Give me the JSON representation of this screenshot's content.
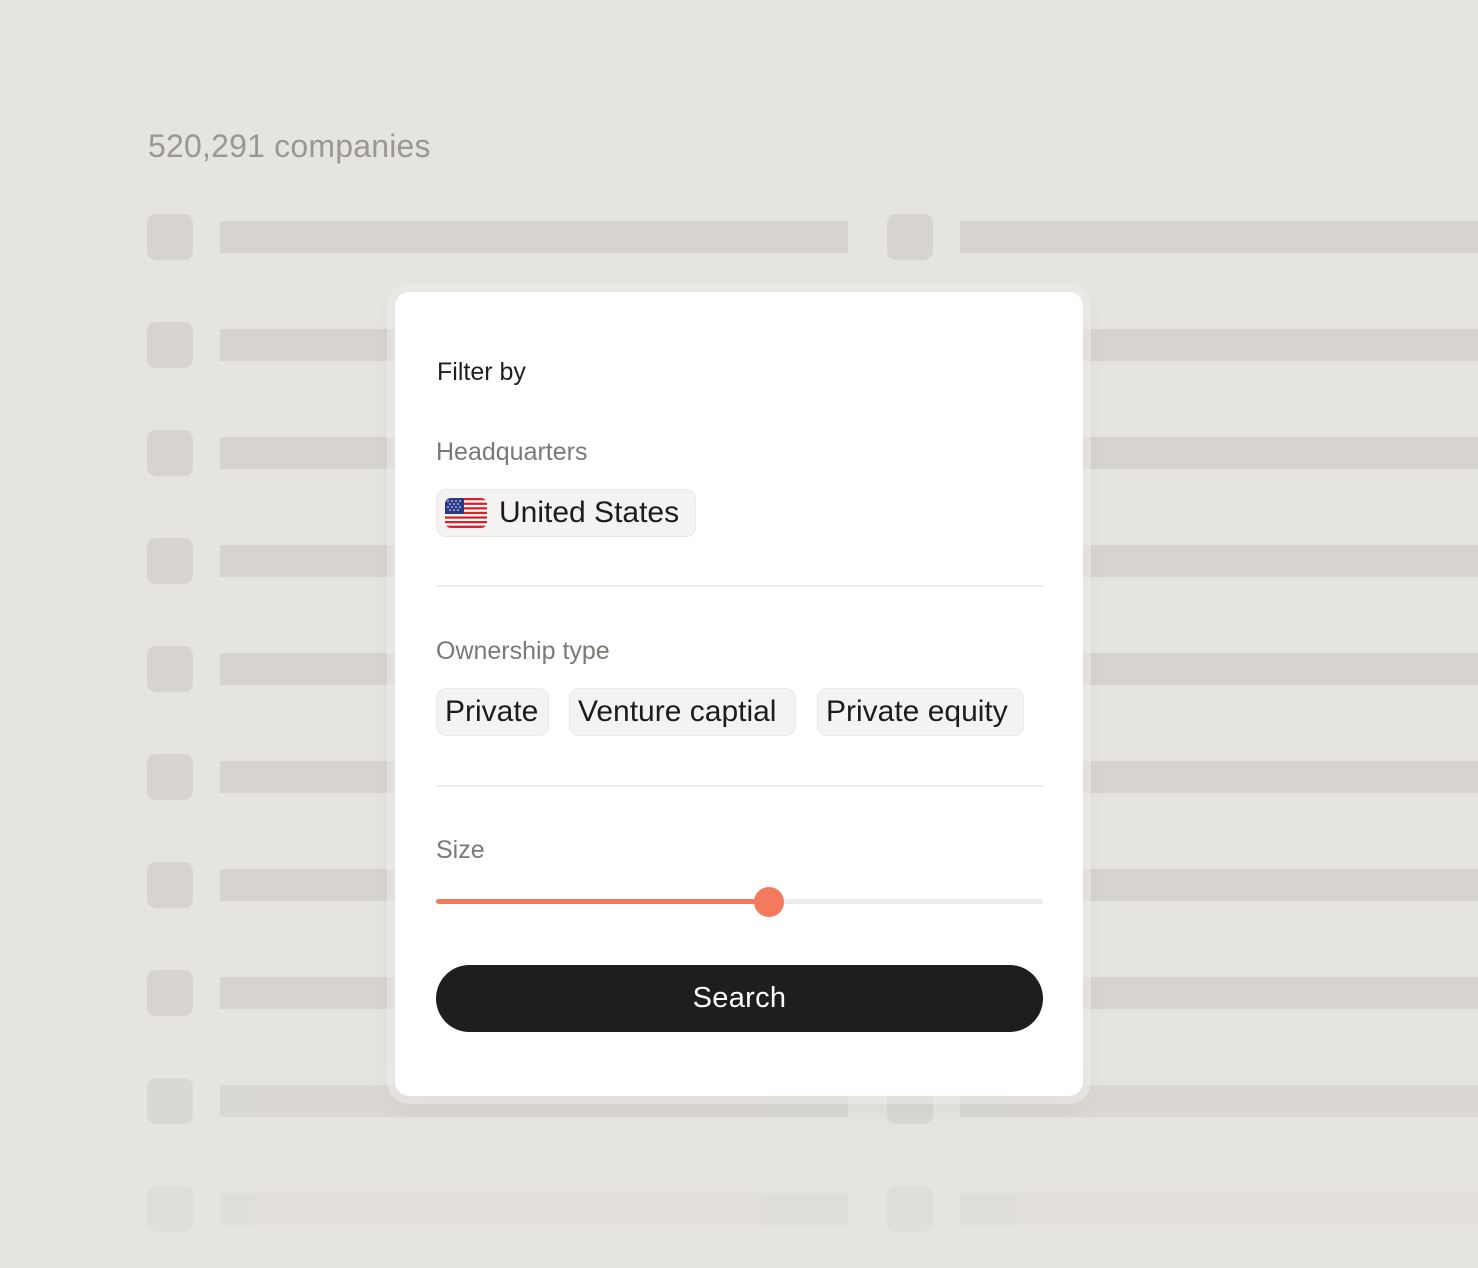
{
  "results": {
    "count_label": "520,291 companies"
  },
  "filter_panel": {
    "title": "Filter by",
    "headquarters": {
      "label": "Headquarters",
      "selected": [
        {
          "label": "United States",
          "icon": "us-flag-icon"
        }
      ]
    },
    "ownership": {
      "label": "Ownership type",
      "options": [
        "Private",
        "Venture captial",
        "Private equity"
      ]
    },
    "size": {
      "label": "Size",
      "value_fraction": 0.548
    },
    "search_label": "Search"
  },
  "colors": {
    "background": "#e6e4e0",
    "skeleton": "#d7d4d0",
    "accent": "#f47a5d",
    "button": "#1e1e1e",
    "panel": "#ffffff"
  }
}
